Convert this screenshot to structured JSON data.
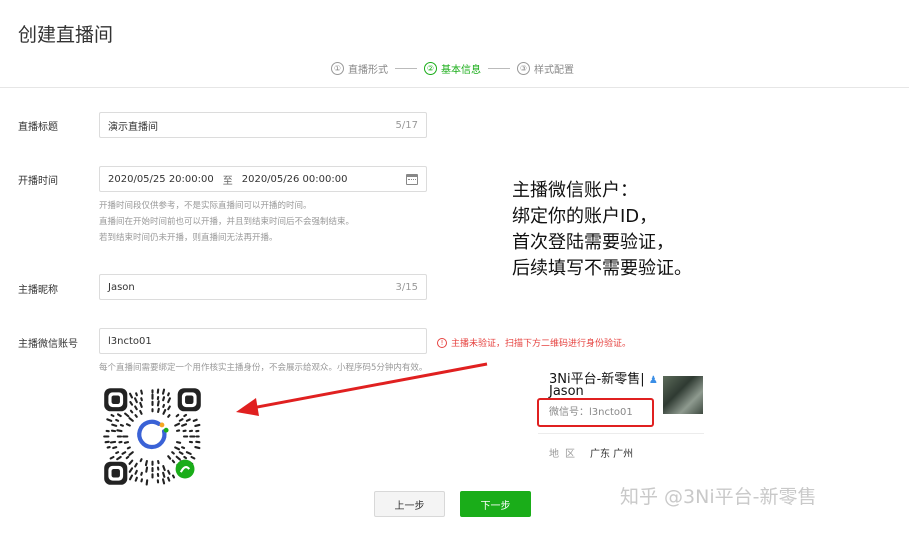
{
  "page": {
    "title": "创建直播间"
  },
  "steps": [
    {
      "num": "①",
      "label": "直播形式"
    },
    {
      "num": "②",
      "label": "基本信息"
    },
    {
      "num": "③",
      "label": "样式配置"
    }
  ],
  "form": {
    "title": {
      "label": "直播标题",
      "value": "演示直播间",
      "count": "5/17"
    },
    "time": {
      "label": "开播时间",
      "start": "2020/05/25 20:00:00",
      "separator": "至",
      "end": "2020/05/26 00:00:00",
      "hint_lines": [
        "开播时间段仅供参考，不是实际直播间可以开播的时间。",
        "直播间在开始时间前也可以开播，并且到结束时间后不会强制结束。",
        "若到结束时间仍未开播，则直播间无法再开播。"
      ]
    },
    "nickname": {
      "label": "主播昵称",
      "value": "Jason",
      "count": "3/15"
    },
    "wechat_account": {
      "label": "主播微信账号",
      "value": "l3ncto01",
      "error_icon": "!",
      "error": "主播未验证，扫描下方二维码进行身份验证。",
      "hint": "每个直播间需要绑定一个用作核实主播身份，不会展示给观众。小程序码5分钟内有效。"
    }
  },
  "annotation": {
    "lines": [
      "主播微信账户：",
      "绑定你的账户ID，",
      "首次登陆需要验证，",
      "后续填写不需要验证。"
    ]
  },
  "profile": {
    "name": "3Ni平台-新零售|",
    "nickname": "Jason",
    "wechat_id": "微信号：l3ncto01",
    "region_label": "地区",
    "region_value": "广东 广州"
  },
  "buttons": {
    "prev": "上一步",
    "next": "下一步"
  },
  "watermark": "知乎 @3Ni平台-新零售",
  "colors": {
    "accent": "#1aad19",
    "error": "#e64340",
    "arrow": "#e02020"
  }
}
